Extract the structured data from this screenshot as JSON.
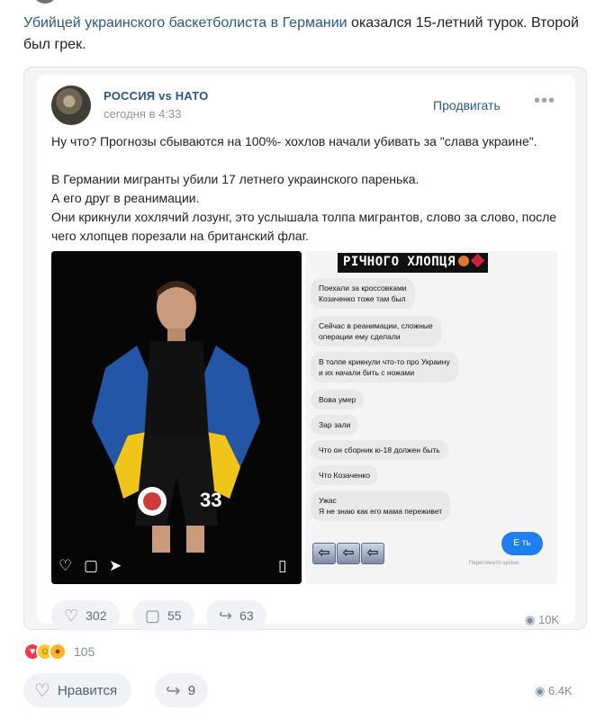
{
  "post": {
    "text_link": "Убийцей украинского баскетболиста в Германии",
    "text_rest": " оказался 15-летний турок. Второй был грек."
  },
  "repost": {
    "source_name": "РОССИЯ vs НАТО",
    "time": "сегодня в 4:33",
    "promote_label": "Продвигать",
    "more": "•••",
    "paragraphs": [
      "Ну что? Прогнозы сбываются на 100%- хохлов начали убивать за \"слава украине\".",
      "В Германии мигранты убили 17 летнего украинского паренька.",
      "А его друг в реанимации.",
      "Они крикнули хохлячий лозунг, это услышала толпа мигрантов, слово за слово, после чего хлопцев порезали на британский флаг."
    ],
    "chat": {
      "title": "РІЧНОГО ХЛОПЦЯ",
      "bubbles": [
        {
          "lines": [
            "Поехали за кроссовками",
            "Козаченко тоже там был"
          ]
        },
        {
          "lines": [
            "Сейчас в реанимации, сложные",
            "операции ему сделали"
          ]
        },
        {
          "lines": [
            "В толпе крикнули что-то про Украину",
            "и их начали бить с ножами"
          ]
        },
        {
          "lines": [
            "Вова умер"
          ]
        },
        {
          "lines": [
            "Зар  зали"
          ]
        },
        {
          "lines": [
            "Что он сборник ю-18 должен быть"
          ]
        },
        {
          "lines": [
            "Что Козаченко"
          ]
        },
        {
          "lines": [
            "Ужас",
            "Я не знаю как его мама переживет"
          ]
        }
      ],
      "send_label": "Е  ть",
      "seen_note": "Переглянуто щойно",
      "arrow_glyph": "⇦"
    },
    "jersey_number": "33",
    "likes": "302",
    "comments": "55",
    "shares": "63",
    "views": "10K"
  },
  "reactions_count": "105",
  "actions": {
    "like_label": "Нравится",
    "share_count": "9",
    "views": "6.4K"
  },
  "icons": {
    "heart": "♡",
    "comment": "▢",
    "share": "↪",
    "eye": "◉",
    "bookmark": "▯",
    "send": "➤"
  },
  "colors": {
    "link": "#2a5885",
    "meta": "#818c99",
    "pill_bg": "#f0f2f5",
    "send_blue": "#1e7ff0"
  }
}
